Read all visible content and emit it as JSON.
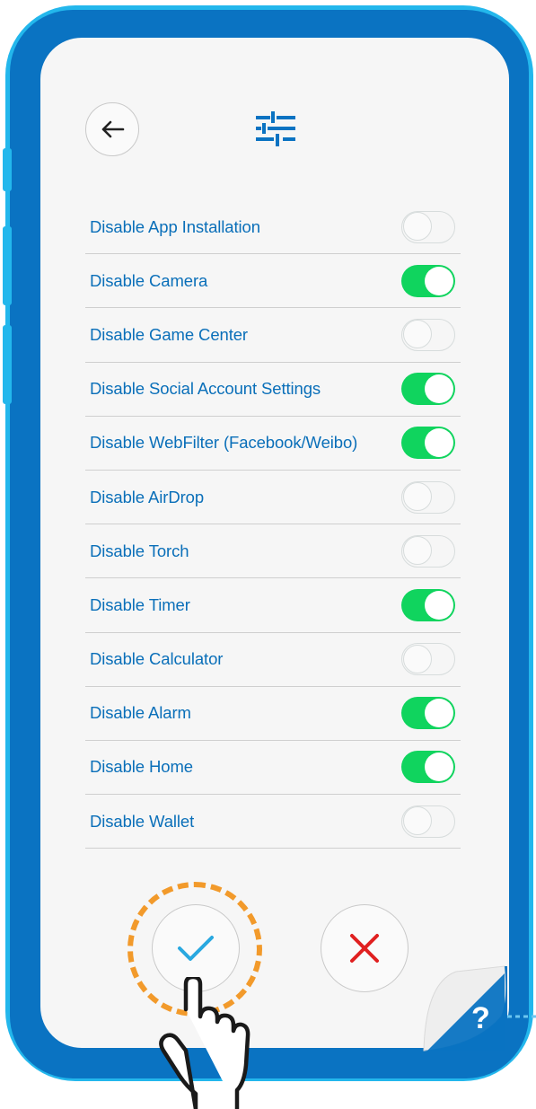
{
  "header": {
    "back_icon": "arrow-left-icon",
    "settings_icon": "sliders-icon"
  },
  "settings": [
    {
      "label": "Disable App Installation",
      "enabled": false
    },
    {
      "label": "Disable Camera",
      "enabled": true
    },
    {
      "label": "Disable Game Center",
      "enabled": false
    },
    {
      "label": "Disable Social Account Settings",
      "enabled": true
    },
    {
      "label": "Disable WebFilter (Facebook/Weibo)",
      "enabled": true
    },
    {
      "label": "Disable AirDrop",
      "enabled": false
    },
    {
      "label": "Disable Torch",
      "enabled": false
    },
    {
      "label": "Disable Timer",
      "enabled": true
    },
    {
      "label": "Disable Calculator",
      "enabled": false
    },
    {
      "label": "Disable Alarm",
      "enabled": true
    },
    {
      "label": "Disable Home",
      "enabled": true
    },
    {
      "label": "Disable Wallet",
      "enabled": false
    }
  ],
  "actions": {
    "confirm_icon": "checkmark-icon",
    "cancel_icon": "close-icon"
  },
  "help": {
    "symbol": "?"
  },
  "colors": {
    "accent": "#0a73c2",
    "frame_light": "#23b7ec",
    "toggle_on": "#10d45e",
    "confirm": "#29a8e0",
    "cancel": "#e02020",
    "highlight_ring": "#f29a2b"
  }
}
